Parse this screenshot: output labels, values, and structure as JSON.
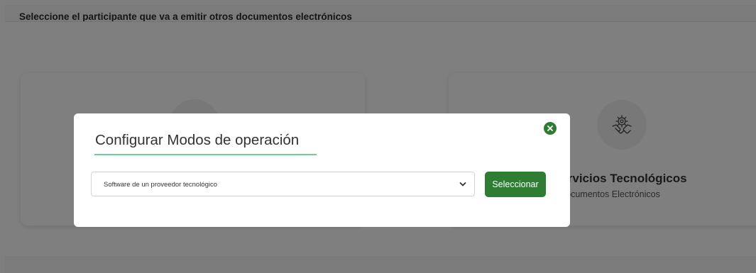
{
  "page": {
    "title": "Seleccione el participante que va a emitir otros documentos electrónicos"
  },
  "cards": [
    {
      "icon": "document-lightning-gear-icon",
      "title": "",
      "subtitle": ""
    },
    {
      "icon": "handshake-gear-icon",
      "title": "de Servicios Tecnológicos",
      "subtitle": "Documentos Electrónicos"
    }
  ],
  "modal": {
    "title": "Configurar Modos de operación",
    "close_icon": "close-icon",
    "select": {
      "value": "Software de un proveedor tecnológico",
      "chevron_icon": "chevron-down-icon"
    },
    "button_label": "Seleccionar"
  },
  "colors": {
    "accent_green": "#2e7d32",
    "underline_green": "#6fcf97",
    "overlay": "rgba(0,0,0,0.5)"
  }
}
